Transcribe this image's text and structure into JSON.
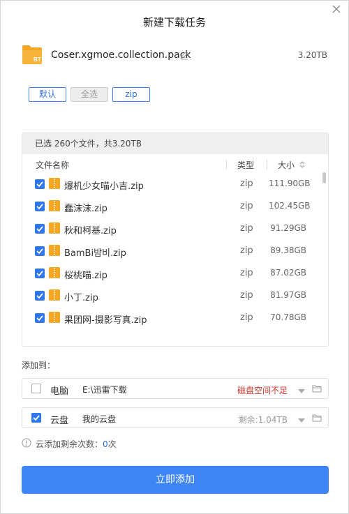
{
  "dialog": {
    "title": "新建下载任务"
  },
  "pack": {
    "icon_label": "BT",
    "name": "Coser.xgmoe.collection.pack",
    "size": "3.20TB"
  },
  "filters": {
    "default_label": "默认",
    "all_label": "全选",
    "zip_label": "zip"
  },
  "file_list": {
    "selection_summary": "已选 260个文件，共3.20TB",
    "columns": {
      "name": "文件名称",
      "type": "类型",
      "size": "大小"
    },
    "files": [
      {
        "name": "爆机少女喵小吉.zip",
        "type": "zip",
        "size": "111.90GB",
        "checked": true
      },
      {
        "name": "蠢沫沫.zip",
        "type": "zip",
        "size": "102.45GB",
        "checked": true
      },
      {
        "name": "秋和柯基.zip",
        "type": "zip",
        "size": "91.29GB",
        "checked": true
      },
      {
        "name": "BamBi밤비.zip",
        "type": "zip",
        "size": "89.38GB",
        "checked": true
      },
      {
        "name": "桜桃喵.zip",
        "type": "zip",
        "size": "87.02GB",
        "checked": true
      },
      {
        "name": "小丁.zip",
        "type": "zip",
        "size": "81.97GB",
        "checked": true
      },
      {
        "name": "果团网-摄影写真.zip",
        "type": "zip",
        "size": "70.78GB",
        "checked": true
      }
    ]
  },
  "destinations": {
    "heading": "添加到：",
    "pc": {
      "label": "电脑",
      "path": "E:\\迅雷下载",
      "status": "磁盘空间不足",
      "checked": false
    },
    "cloud": {
      "label": "云盘",
      "path": "我的云盘",
      "status": "剩余:1.04TB",
      "checked": true
    }
  },
  "quota": {
    "text": "云添加剩余次数：",
    "count": "0",
    "unit": "次"
  },
  "submit": {
    "label": "立即添加"
  },
  "colors": {
    "accent": "#3d84f5",
    "checkbox": "#2f77f0",
    "warning": "#d9362b",
    "folder_orange": "#f5a623"
  }
}
